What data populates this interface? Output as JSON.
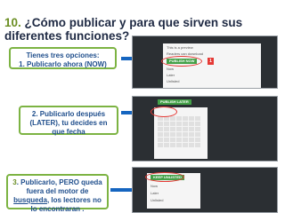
{
  "slide": {
    "number": "10.",
    "title_rest": " ¿Cómo publicar y para que sirven sus diferentes funciones?"
  },
  "callouts": {
    "one_line1": "Tienes tres opciones:",
    "one_line2": "1. Publicarlo ahora (NOW)",
    "two_text": "2. Publicarlo después (LATER), tu decides en que fecha",
    "three_num": "3",
    "three_a": ". Publicarlo, PERO queda fuera del motor de ",
    "three_u": "busqueda",
    "three_b": ", los lectores no lo encontraran ."
  },
  "screenshots": {
    "s1_row1": "This is a preview",
    "s1_row2": "Readers can download",
    "s1_button": "PUBLISH NOW",
    "s1_opt1": "Now",
    "s1_opt2": "Later",
    "s1_opt3": "Unlisted",
    "s2_button": "PUBLISH LATER",
    "s3_button": "KEEP UNLISTED",
    "s3_opt1": "Now",
    "s3_opt2": "Later",
    "s3_opt3": "Unlisted"
  },
  "colors": {
    "accent": "#6b8e23",
    "callout_text": "#1f4e8c",
    "callout_border": "#7cb342",
    "arrow": "#1565c0",
    "highlight": "#e53935"
  }
}
